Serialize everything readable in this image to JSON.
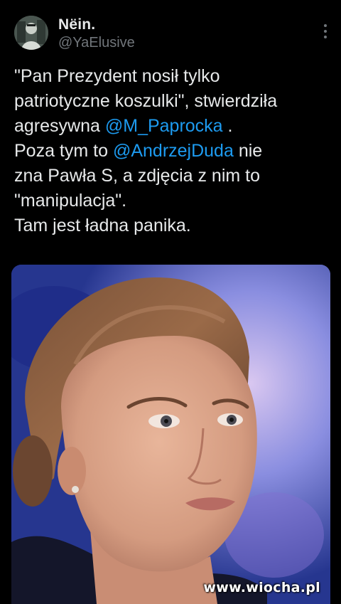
{
  "tweet": {
    "author": {
      "name": "Nëin.",
      "handle": "@YaElusive"
    },
    "text_lines": [
      [
        {
          "t": "\"Pan Prezydent nosił tylko"
        }
      ],
      [
        {
          "t": "patriotyczne koszulki\", stwierdziła"
        }
      ],
      [
        {
          "t": "agresywna "
        },
        {
          "t": "@M_Paprocka",
          "mention": true
        },
        {
          "t": " ."
        }
      ],
      [
        {
          "t": "Poza tym to "
        },
        {
          "t": "@AndrzejDuda",
          "mention": true
        },
        {
          "t": " nie"
        }
      ],
      [
        {
          "t": "zna Pawła S, a zdjęcia z nim to"
        }
      ],
      [
        {
          "t": "\"manipulacja\"."
        }
      ],
      [
        {
          "t": "Tam jest ładna panika."
        }
      ]
    ],
    "more_icon": "more-vertical-icon",
    "mention_color": "#1d9bf0"
  },
  "media": {
    "watermark": "www.wiocha.pl"
  }
}
